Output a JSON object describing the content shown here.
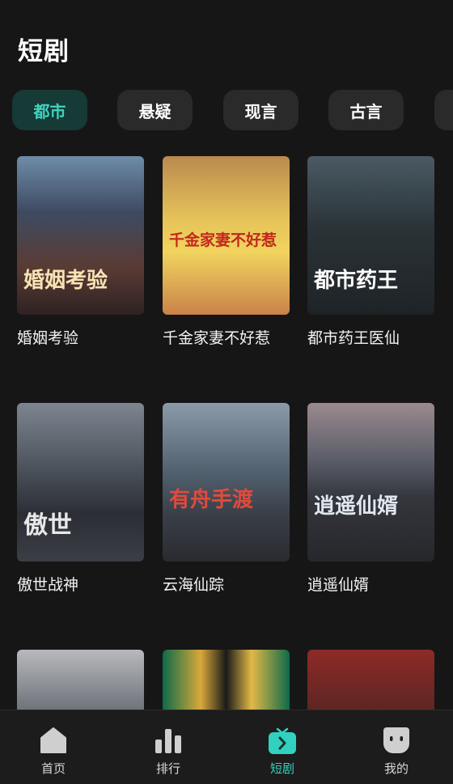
{
  "header": {
    "title": "短剧"
  },
  "tabs": [
    {
      "label": "都市",
      "active": true
    },
    {
      "label": "悬疑",
      "active": false
    },
    {
      "label": "现言",
      "active": false
    },
    {
      "label": "古言",
      "active": false
    },
    {
      "label": "",
      "active": false
    }
  ],
  "dramas": [
    {
      "title": "婚姻考验",
      "poster_text": "婚姻考验"
    },
    {
      "title": "千金家妻不好惹",
      "poster_text": "千金家妻不好惹"
    },
    {
      "title": "都市药王医仙",
      "poster_text": "都市药王"
    },
    {
      "title": "傲世战神",
      "poster_text": "傲世"
    },
    {
      "title": "云海仙踪",
      "poster_text": "有舟手渡"
    },
    {
      "title": "逍遥仙婿",
      "poster_text": "逍遥仙婿"
    },
    {
      "title": "",
      "poster_text": ""
    },
    {
      "title": "",
      "poster_text": ""
    },
    {
      "title": "",
      "poster_text": ""
    }
  ],
  "bottom_nav": [
    {
      "label": "首页",
      "icon": "home-icon",
      "active": false
    },
    {
      "label": "排行",
      "icon": "ranking-icon",
      "active": false
    },
    {
      "label": "短剧",
      "icon": "short-drama-icon",
      "active": true
    },
    {
      "label": "我的",
      "icon": "profile-icon",
      "active": false
    }
  ],
  "colors": {
    "accent": "#32d1bf",
    "background": "#161616",
    "tab_active_bg": "#163a36"
  }
}
